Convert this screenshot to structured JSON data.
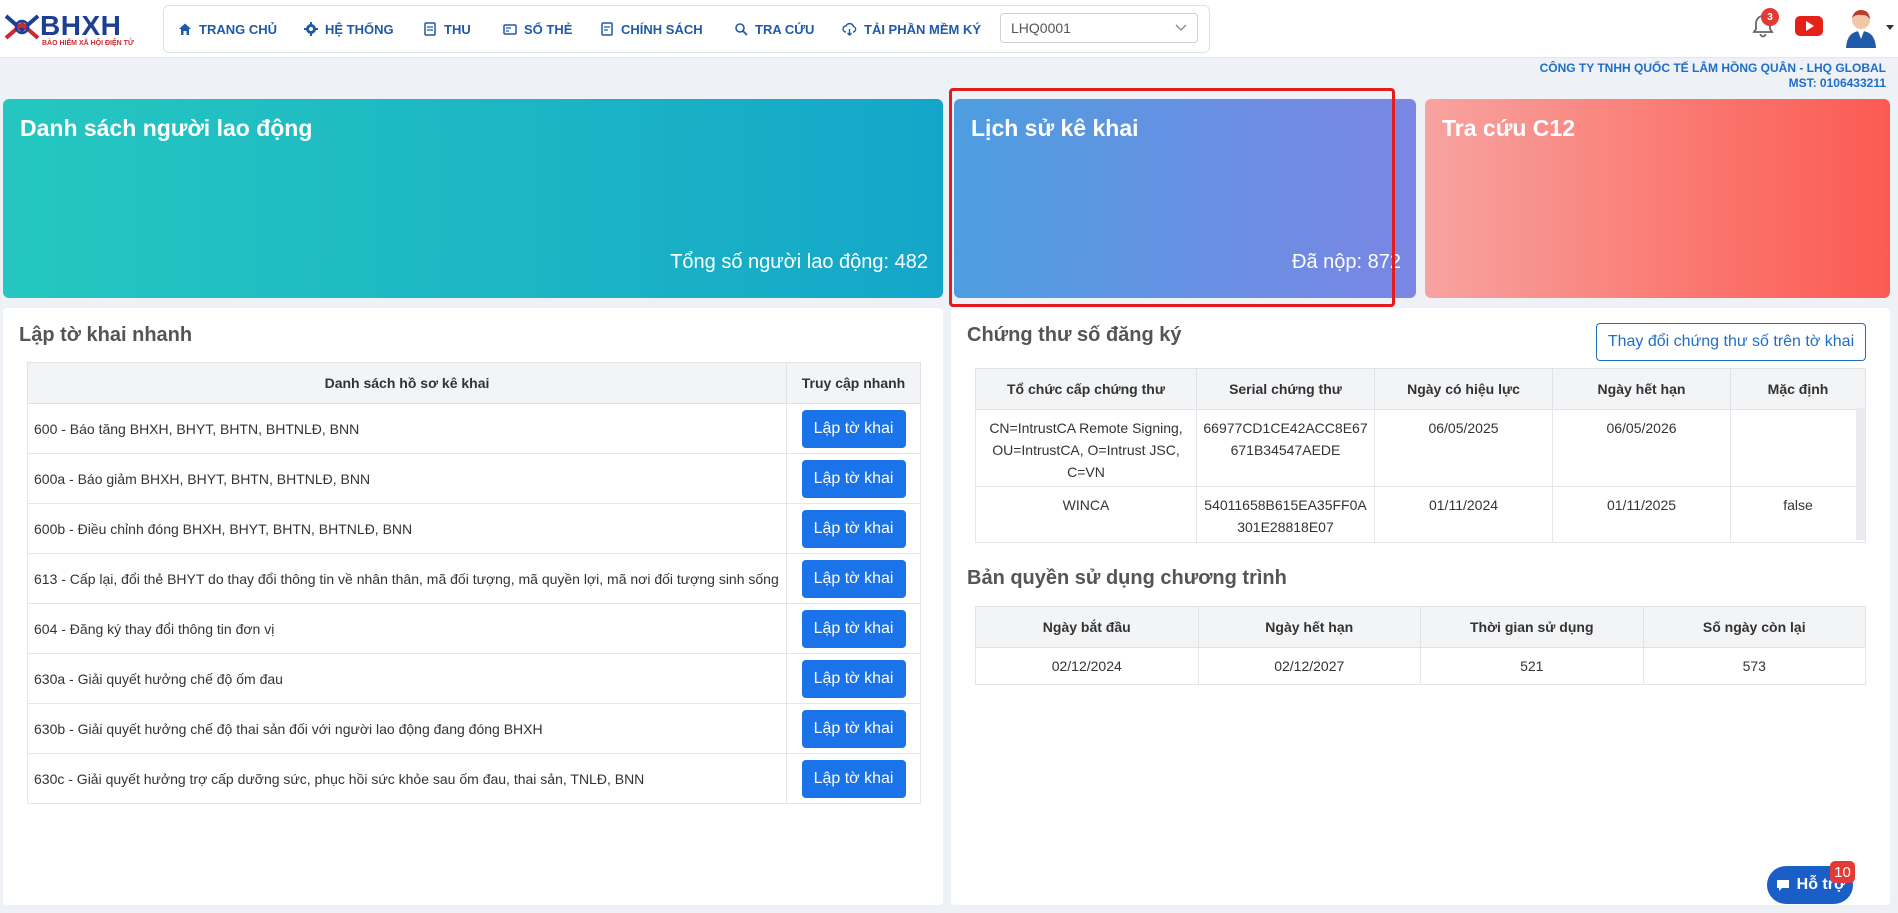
{
  "logo": {
    "text": "BHXH",
    "subtitle": "BẢO HIỂM XÃ HỘI ĐIỆN TỬ"
  },
  "nav": {
    "items": [
      {
        "label": "TRANG CHỦ",
        "icon": "home-icon"
      },
      {
        "label": "HỆ THỐNG",
        "icon": "gear-icon"
      },
      {
        "label": "THU",
        "icon": "document-icon"
      },
      {
        "label": "SỔ THẺ",
        "icon": "card-icon"
      },
      {
        "label": "CHÍNH SÁCH",
        "icon": "policy-icon"
      },
      {
        "label": "TRA CỨU",
        "icon": "search-icon"
      },
      {
        "label": "TẢI PHẦN MỀM KÝ",
        "icon": "cloud-download-icon"
      }
    ],
    "select_value": "LHQ0001"
  },
  "header": {
    "notification_count": "3"
  },
  "company": {
    "name": "CÔNG TY TNHH QUỐC TẾ LÂM HỒNG QUÂN - LHQ GLOBAL",
    "tax_code": "MST: 0106433211"
  },
  "cards": [
    {
      "title": "Danh sách người lao động",
      "value": "Tổng số người lao động: 482"
    },
    {
      "title": "Lịch sử kê khai",
      "value": "Đã nộp: 872"
    },
    {
      "title": "Tra cứu C12",
      "value": ""
    }
  ],
  "quick": {
    "title": "Lập tờ khai nhanh",
    "headers": [
      "Danh sách hồ sơ kê khai",
      "Truy cập nhanh"
    ],
    "button_label": "Lập tờ khai",
    "rows": [
      "600 - Báo tăng BHXH, BHYT, BHTN, BHTNLĐ, BNN",
      "600a - Báo giảm BHXH, BHYT, BHTN, BHTNLĐ, BNN",
      "600b - Điều chỉnh đóng BHXH, BHYT, BHTN, BHTNLĐ, BNN",
      "613 - Cấp lại, đổi thẻ BHYT do thay đổi thông tin về nhân thân, mã đối tượng, mã quyền lợi, mã nơi đối tượng sinh sống",
      "604 - Đăng ký thay đổi thông tin đơn vị",
      "630a - Giải quyết hưởng chế độ ốm đau",
      "630b - Giải quyết hưởng chế độ thai sản đối với người lao động đang đóng BHXH",
      "630c - Giải quyết hưởng trợ cấp dưỡng sức, phục hồi sức khỏe sau ốm đau, thai sản, TNLĐ, BNN"
    ]
  },
  "certs": {
    "title": "Chứng thư số đăng ký",
    "change_button": "Thay đổi chứng thư số trên tờ khai",
    "headers": [
      "Tổ chức cấp chứng thư",
      "Serial chứng thư",
      "Ngày có hiệu lực",
      "Ngày hết hạn",
      "Mặc định"
    ],
    "rows": [
      {
        "issuer": "CN=IntrustCA Remote Signing, OU=IntrustCA, O=Intrust JSC, C=VN",
        "serial": "66977CD1CE42ACC8E67671B34547AEDE",
        "valid_from": "06/05/2025",
        "valid_to": "06/05/2026",
        "default": ""
      },
      {
        "issuer": "WINCA",
        "serial": "54011658B615EA35FF0A301E28818E07",
        "valid_from": "01/11/2024",
        "valid_to": "01/11/2025",
        "default": "false"
      }
    ]
  },
  "license": {
    "title": "Bản quyền sử dụng chương trình",
    "headers": [
      "Ngày bắt đầu",
      "Ngày hết hạn",
      "Thời gian sử dụng",
      "Số ngày còn lại"
    ],
    "row": [
      "02/12/2024",
      "02/12/2027",
      "521",
      "573"
    ]
  },
  "help": {
    "label": "Hỗ trợ",
    "badge": "10"
  },
  "colors": {
    "brand_blue": "#1e5aa8",
    "button_blue": "#1a73e8",
    "highlight_red": "#e01c1c"
  }
}
